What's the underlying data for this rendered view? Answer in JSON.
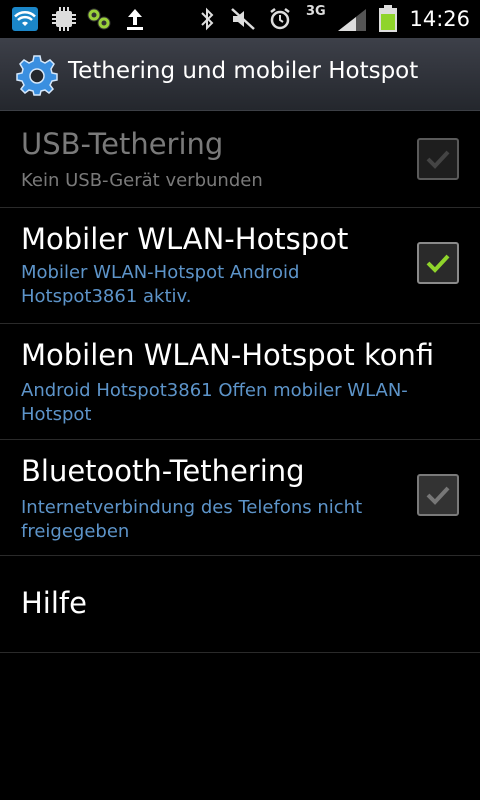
{
  "status_bar": {
    "time": "14:26",
    "network": "3G",
    "icons": [
      "wifi-icon",
      "chip-icon",
      "android-share-icon",
      "upload-icon",
      "bluetooth-icon",
      "mute-icon",
      "alarm-icon",
      "signal-icon",
      "battery-icon"
    ]
  },
  "action_bar": {
    "title": "Tethering und mobiler Hotspot",
    "icon": "gear-icon"
  },
  "items": [
    {
      "title": "USB-Tethering",
      "subtitle": "Kein USB-Gerät verbunden",
      "checked": false,
      "enabled": false
    },
    {
      "title": "Mobiler WLAN-Hotspot",
      "subtitle": "Mobiler WLAN-Hotspot Android Hotspot3861 aktiv.",
      "checked": true,
      "enabled": true
    },
    {
      "title": "Mobilen WLAN-Hotspot konfi",
      "subtitle": "Android Hotspot3861 Offen mobiler WLAN-Hotspot",
      "enabled": true
    },
    {
      "title": "Bluetooth-Tethering",
      "subtitle": "Internetverbindung des Telefons nicht freigegeben",
      "checked": false,
      "enabled": true
    },
    {
      "title": "Hilfe",
      "enabled": true
    }
  ],
  "colors": {
    "accent_check": "#8fd42b",
    "subtitle": "#5d94c9",
    "background": "#000000"
  }
}
